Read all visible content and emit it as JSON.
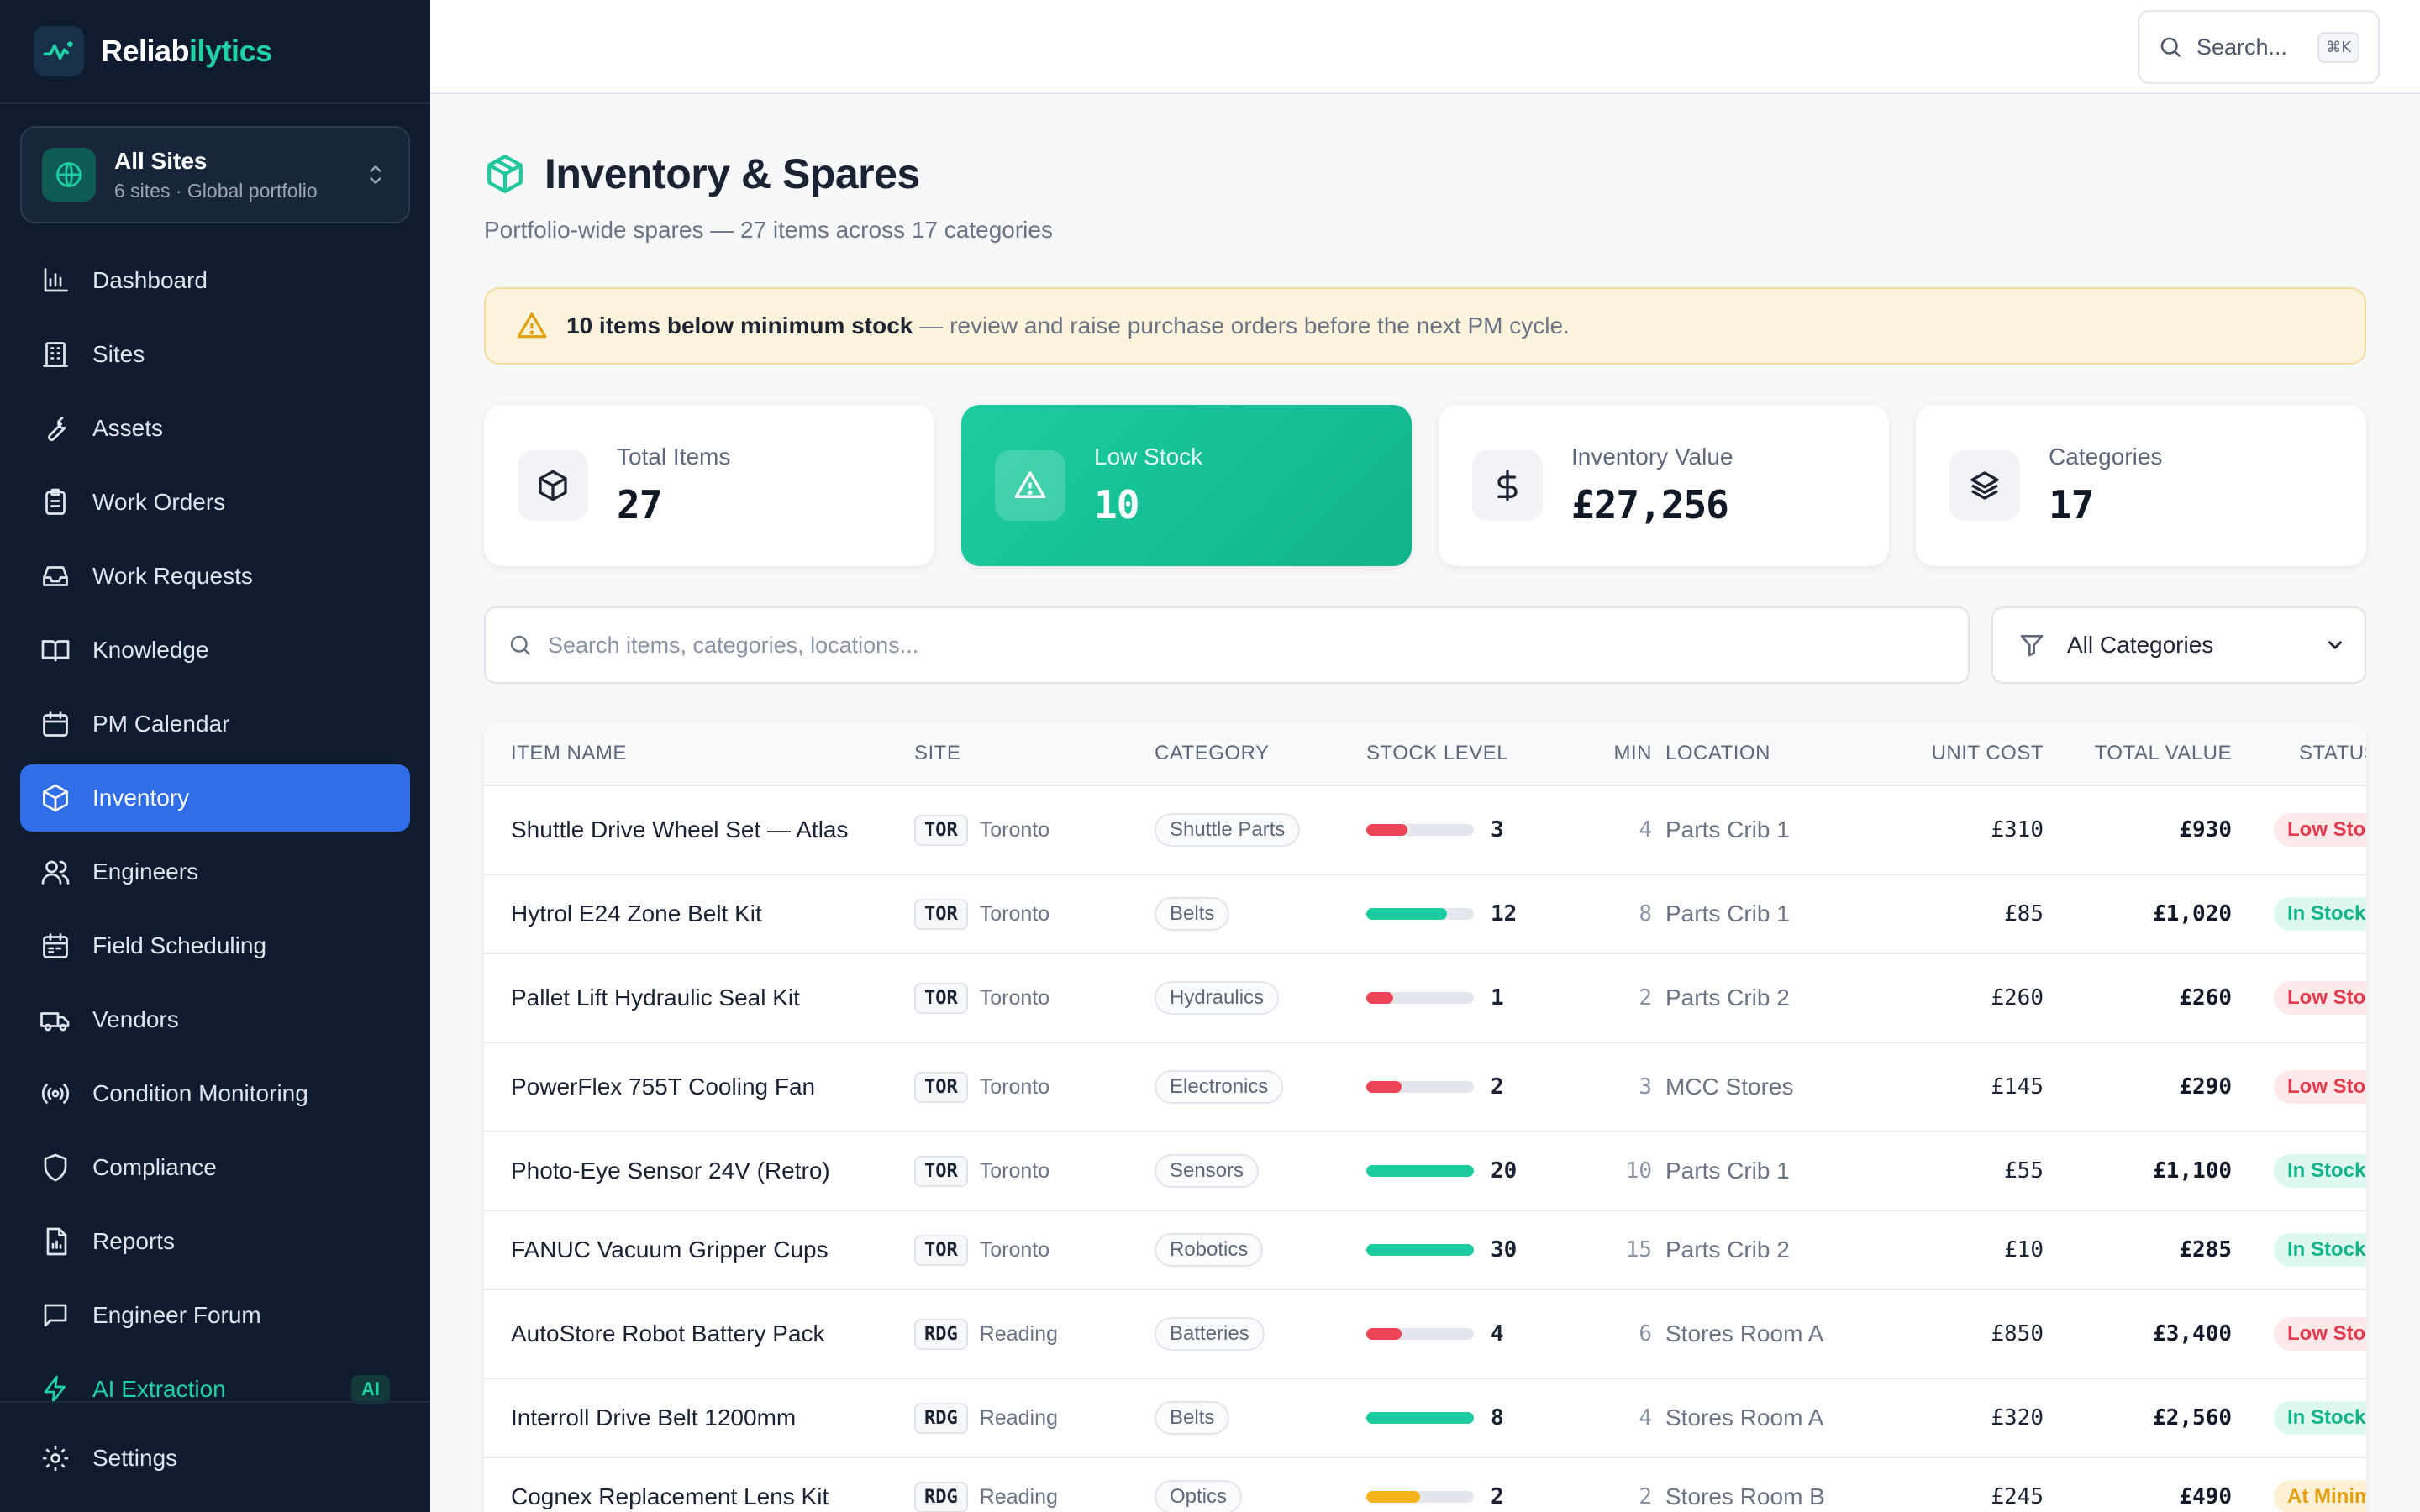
{
  "brand": {
    "name_prefix": "Reliab",
    "name_accent": "ilytics"
  },
  "site_switcher": {
    "title": "All Sites",
    "subtitle": "6 sites · Global portfolio"
  },
  "nav": {
    "items": [
      {
        "label": "Dashboard",
        "icon": "bar-chart-icon"
      },
      {
        "label": "Sites",
        "icon": "building-icon"
      },
      {
        "label": "Assets",
        "icon": "wrench-icon"
      },
      {
        "label": "Work Orders",
        "icon": "clipboard-icon"
      },
      {
        "label": "Work Requests",
        "icon": "inbox-icon"
      },
      {
        "label": "Knowledge",
        "icon": "book-icon"
      },
      {
        "label": "PM Calendar",
        "icon": "calendar-icon"
      },
      {
        "label": "Inventory",
        "icon": "package-icon"
      },
      {
        "label": "Engineers",
        "icon": "users-icon"
      },
      {
        "label": "Field Scheduling",
        "icon": "calendar-check-icon"
      },
      {
        "label": "Vendors",
        "icon": "truck-icon"
      },
      {
        "label": "Condition Monitoring",
        "icon": "radio-icon"
      },
      {
        "label": "Compliance",
        "icon": "shield-icon"
      },
      {
        "label": "Reports",
        "icon": "report-icon"
      },
      {
        "label": "Engineer Forum",
        "icon": "chat-icon"
      },
      {
        "label": "AI Extraction",
        "icon": "bolt-icon",
        "badge": "AI"
      }
    ],
    "active": "Inventory",
    "settings_label": "Settings"
  },
  "topbar": {
    "search_label": "Search...",
    "shortcut": "⌘K"
  },
  "page": {
    "title": "Inventory & Spares",
    "subtitle": "Portfolio-wide spares — 27 items across 17 categories"
  },
  "alert": {
    "bold": "10 items below minimum stock",
    "rest": "— review and raise purchase orders before the next PM cycle."
  },
  "stats": {
    "total_items": {
      "label": "Total Items",
      "value": "27"
    },
    "low_stock": {
      "label": "Low Stock",
      "value": "10"
    },
    "inventory_value": {
      "label": "Inventory Value",
      "value": "£27,256"
    },
    "categories": {
      "label": "Categories",
      "value": "17"
    }
  },
  "filters": {
    "search_placeholder": "Search items, categories, locations...",
    "category_value": "All Categories"
  },
  "table": {
    "headers": {
      "item_name": "ITEM NAME",
      "site": "SITE",
      "category": "CATEGORY",
      "stock_level": "STOCK LEVEL",
      "min": "MIN",
      "location": "LOCATION",
      "unit_cost": "UNIT COST",
      "total_value": "TOTAL VALUE",
      "status": "STATUS"
    },
    "rows": [
      {
        "name": "Shuttle Drive Wheel Set — Atlas",
        "site_code": "TOR",
        "site": "Toronto",
        "category": "Shuttle Parts",
        "stock": "3",
        "stock_fraction": 0.38,
        "min": "4",
        "location": "Parts Crib 1",
        "unit_cost": "£310",
        "total": "£930",
        "status": "Low Stock",
        "status_type": "low"
      },
      {
        "name": "Hytrol E24 Zone Belt Kit",
        "site_code": "TOR",
        "site": "Toronto",
        "category": "Belts",
        "stock": "12",
        "stock_fraction": 0.75,
        "min": "8",
        "location": "Parts Crib 1",
        "unit_cost": "£85",
        "total": "£1,020",
        "status": "In Stock",
        "status_type": "in"
      },
      {
        "name": "Pallet Lift Hydraulic Seal Kit",
        "site_code": "TOR",
        "site": "Toronto",
        "category": "Hydraulics",
        "stock": "1",
        "stock_fraction": 0.25,
        "min": "2",
        "location": "Parts Crib 2",
        "unit_cost": "£260",
        "total": "£260",
        "status": "Low Stock",
        "status_type": "low"
      },
      {
        "name": "PowerFlex 755T Cooling Fan",
        "site_code": "TOR",
        "site": "Toronto",
        "category": "Electronics",
        "stock": "2",
        "stock_fraction": 0.33,
        "min": "3",
        "location": "MCC Stores",
        "unit_cost": "£145",
        "total": "£290",
        "status": "Low Stock",
        "status_type": "low"
      },
      {
        "name": "Photo-Eye Sensor 24V (Retro)",
        "site_code": "TOR",
        "site": "Toronto",
        "category": "Sensors",
        "stock": "20",
        "stock_fraction": 1.0,
        "min": "10",
        "location": "Parts Crib 1",
        "unit_cost": "£55",
        "total": "£1,100",
        "status": "In Stock",
        "status_type": "in"
      },
      {
        "name": "FANUC Vacuum Gripper Cups",
        "site_code": "TOR",
        "site": "Toronto",
        "category": "Robotics",
        "stock": "30",
        "stock_fraction": 1.0,
        "min": "15",
        "location": "Parts Crib 2",
        "unit_cost": "£10",
        "total": "£285",
        "status": "In Stock",
        "status_type": "in"
      },
      {
        "name": "AutoStore Robot Battery Pack",
        "site_code": "RDG",
        "site": "Reading",
        "category": "Batteries",
        "stock": "4",
        "stock_fraction": 0.33,
        "min": "6",
        "location": "Stores Room A",
        "unit_cost": "£850",
        "total": "£3,400",
        "status": "Low Stock",
        "status_type": "low"
      },
      {
        "name": "Interroll Drive Belt 1200mm",
        "site_code": "RDG",
        "site": "Reading",
        "category": "Belts",
        "stock": "8",
        "stock_fraction": 1.0,
        "min": "4",
        "location": "Stores Room A",
        "unit_cost": "£320",
        "total": "£2,560",
        "status": "In Stock",
        "status_type": "in"
      },
      {
        "name": "Cognex Replacement Lens Kit",
        "site_code": "RDG",
        "site": "Reading",
        "category": "Optics",
        "stock": "2",
        "stock_fraction": 0.5,
        "min": "2",
        "location": "Stores Room B",
        "unit_cost": "£245",
        "total": "£490",
        "status": "At Minimum",
        "status_type": "min"
      }
    ]
  },
  "colors": {
    "accent": "#1fd1a5",
    "active_nav": "#2f6ee8",
    "low": "#ef4455",
    "ok": "#1ccc9e",
    "warn": "#f5b31a"
  }
}
